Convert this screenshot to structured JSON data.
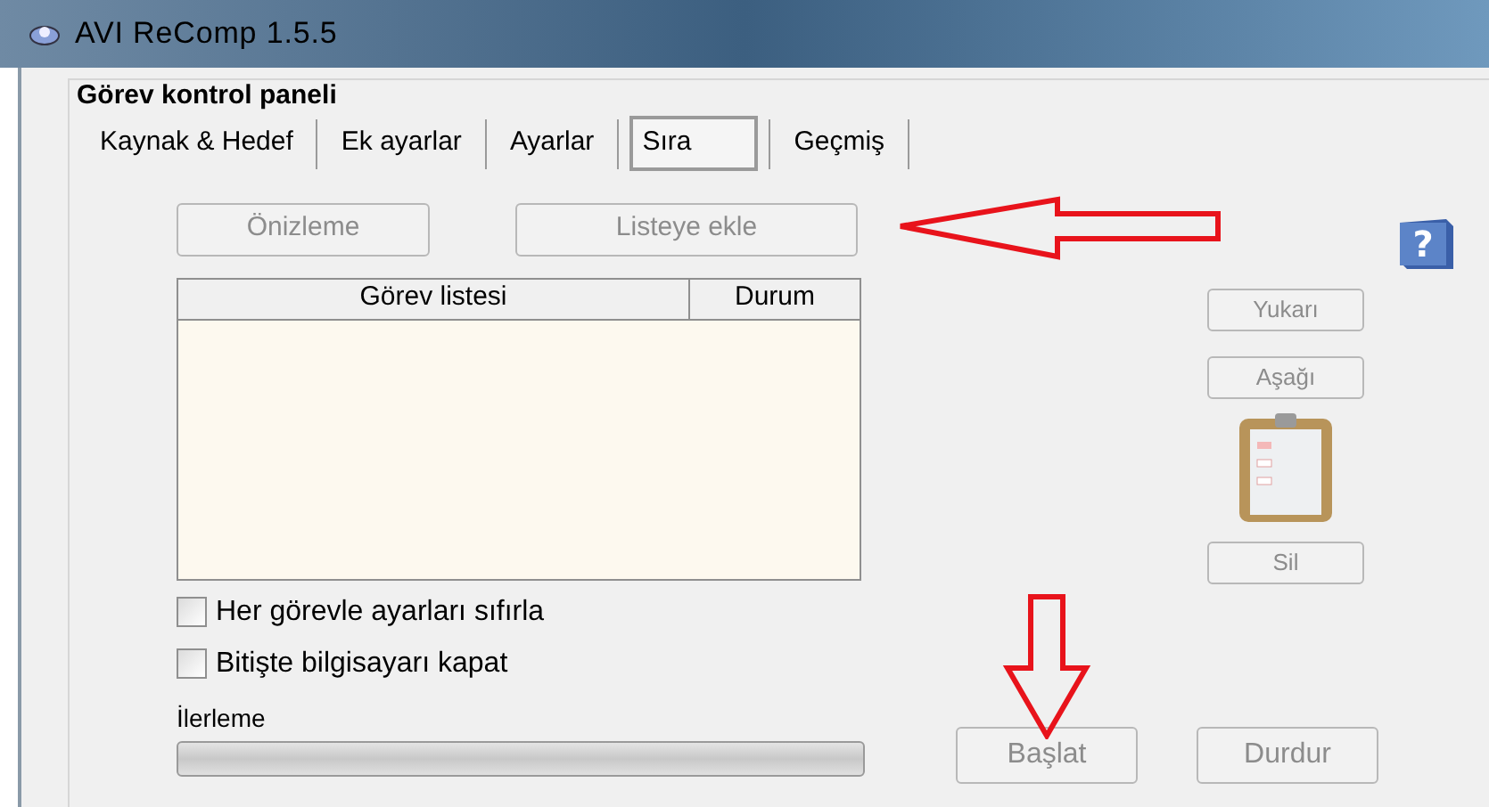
{
  "window": {
    "title": "AVI ReComp  1.5.5"
  },
  "group_title": "Görev kontrol paneli",
  "help_icon": "?",
  "tabs": [
    {
      "label": "Kaynak & Hedef",
      "selected": false
    },
    {
      "label": "Ek ayarlar",
      "selected": false
    },
    {
      "label": "Ayarlar",
      "selected": false
    },
    {
      "label": "Sıra",
      "selected": true
    },
    {
      "label": "Geçmiş",
      "selected": false
    }
  ],
  "top_buttons": [
    {
      "label": "Önizleme",
      "disabled": true
    },
    {
      "label": "Listeye ekle",
      "disabled": true
    }
  ],
  "table": {
    "columns": [
      "Görev listesi",
      "Durum"
    ]
  },
  "side_buttons": [
    {
      "label": "Yukarı",
      "disabled": true
    },
    {
      "label": "Aşağı",
      "disabled": true
    },
    {
      "label": "Sil",
      "disabled": true
    }
  ],
  "checkboxes": [
    {
      "label": "Her görevle ayarları sıfırla",
      "checked": false
    },
    {
      "label": "Bitişte bilgisayarı kapat",
      "checked": false
    }
  ],
  "progress": {
    "label": "İlerleme",
    "level": 0
  },
  "bottom_buttons": [
    {
      "label": "Başlat",
      "disabled": true
    },
    {
      "label": "Durdur",
      "disabled": true
    }
  ]
}
